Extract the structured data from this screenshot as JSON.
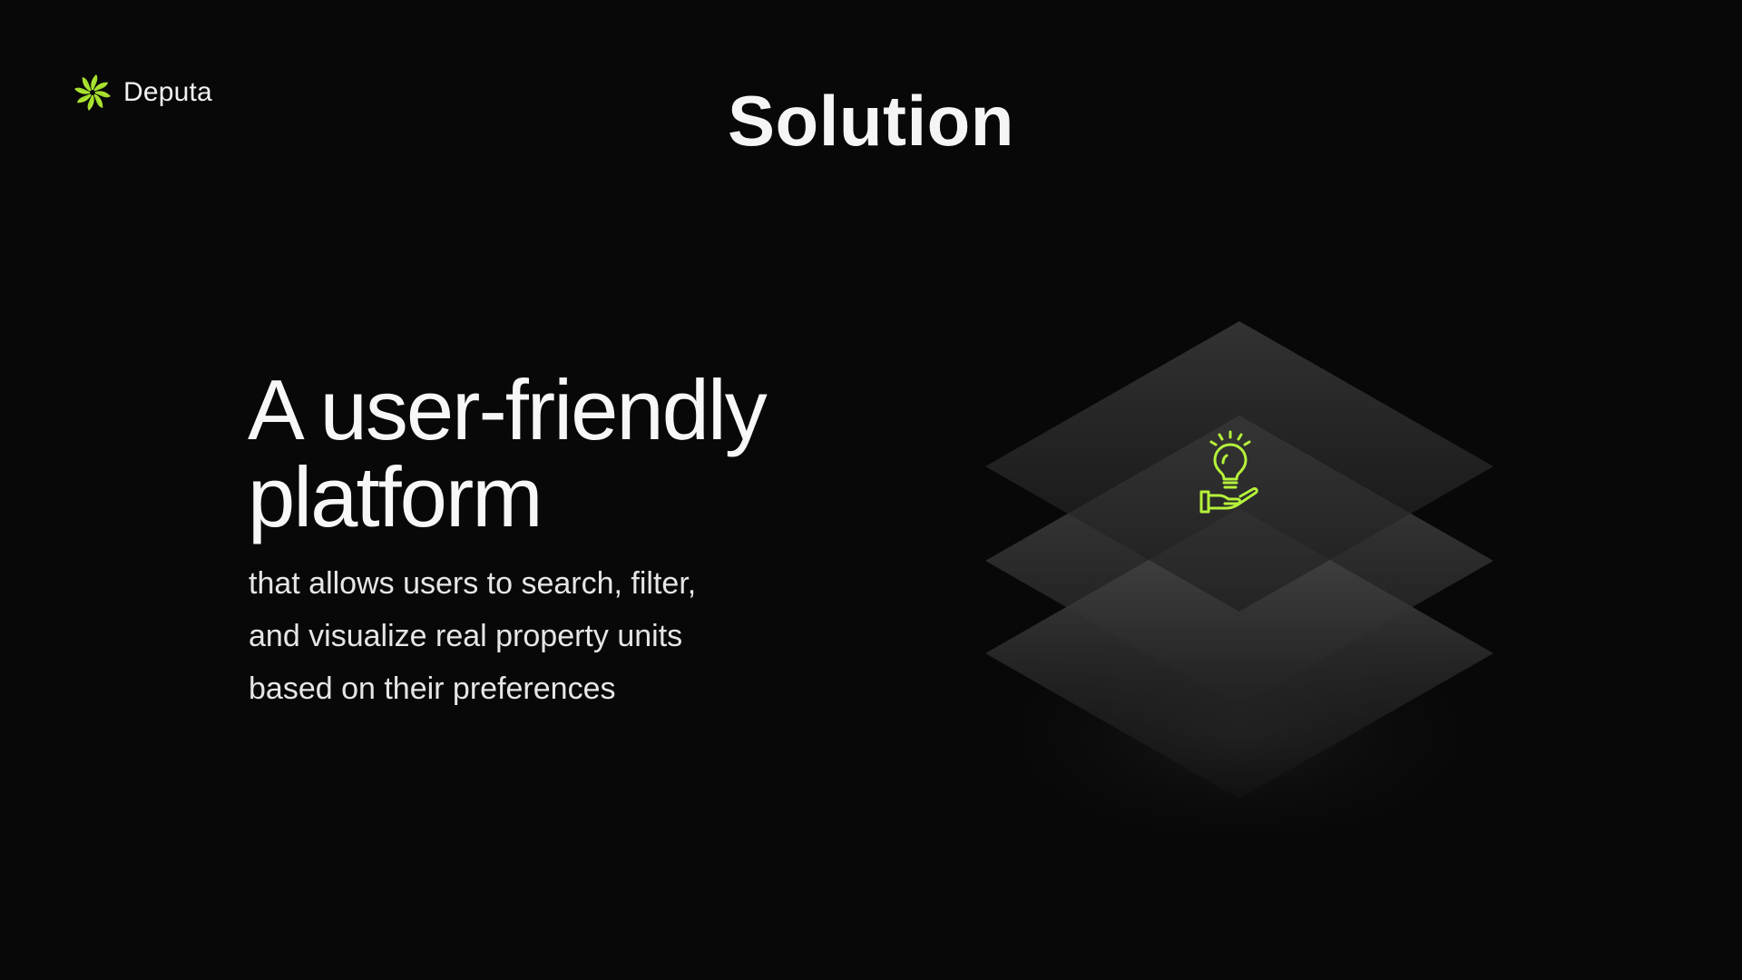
{
  "brand": {
    "name": "Deputa",
    "logo_icon": "pinwheel-logo-icon",
    "accent_color": "#a6e22e"
  },
  "slide": {
    "title": "Solution",
    "headline_lines": [
      "A user-friendly",
      "platform"
    ],
    "body_lines": [
      "that allows users to search, filter,",
      "and visualize real property units",
      "based on their preferences"
    ]
  },
  "illustration": {
    "icon": "lightbulb-in-hand-icon",
    "icon_color": "#b5f23a",
    "layers": 3
  },
  "colors": {
    "background": "#080808",
    "text": "#f5f5f5"
  }
}
